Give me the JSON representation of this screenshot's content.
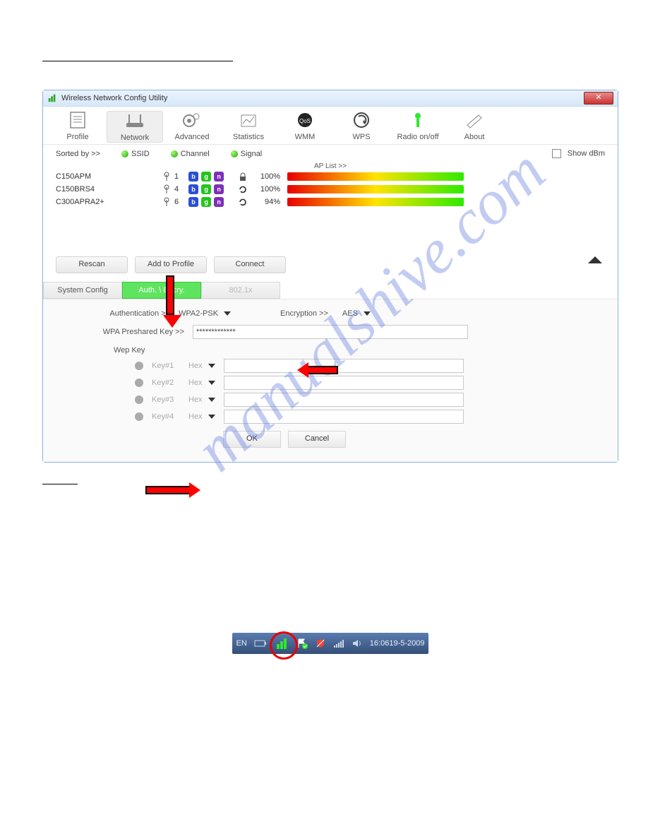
{
  "watermark": "manualshive.com",
  "window": {
    "title": "Wireless Network Config Utility"
  },
  "toolbar": {
    "profile": "Profile",
    "network": "Network",
    "advanced": "Advanced",
    "statistics": "Statistics",
    "wmm": "WMM",
    "wps": "WPS",
    "radio": "Radio on/off",
    "about": "About"
  },
  "filter": {
    "sorted_by": "Sorted by >>",
    "ssid": "SSID",
    "channel": "Channel",
    "signal": "Signal",
    "show_dbm": "Show dBm",
    "ap_list": "AP List >>"
  },
  "ap_rows": [
    {
      "ssid": "C150APM",
      "ch": "1",
      "signal": "100%"
    },
    {
      "ssid": "C150BRS4",
      "ch": "4",
      "signal": "100%"
    },
    {
      "ssid": "C300APRA2+",
      "ch": "6",
      "signal": "94%"
    }
  ],
  "actions": {
    "rescan": "Rescan",
    "add_to_profile": "Add to Profile",
    "connect": "Connect"
  },
  "tabs": {
    "system_config": "System Config",
    "auth_encry": "Auth. \\ Encry.",
    "dot1x": "802.1x"
  },
  "auth": {
    "auth_label": "Authentication >>",
    "auth_value": "WPA2-PSK",
    "enc_label": "Encryption >>",
    "enc_value": "AES",
    "psk_label": "WPA Preshared Key >>",
    "psk_value": "*************",
    "wep_group": "Wep Key",
    "keys": [
      {
        "name": "Key#1",
        "type": "Hex"
      },
      {
        "name": "Key#2",
        "type": "Hex"
      },
      {
        "name": "Key#3",
        "type": "Hex"
      },
      {
        "name": "Key#4",
        "type": "Hex"
      }
    ],
    "ok": "OK",
    "cancel": "Cancel"
  },
  "tray": {
    "lang": "EN",
    "time": "16:06",
    "date": "19-5-2009"
  }
}
